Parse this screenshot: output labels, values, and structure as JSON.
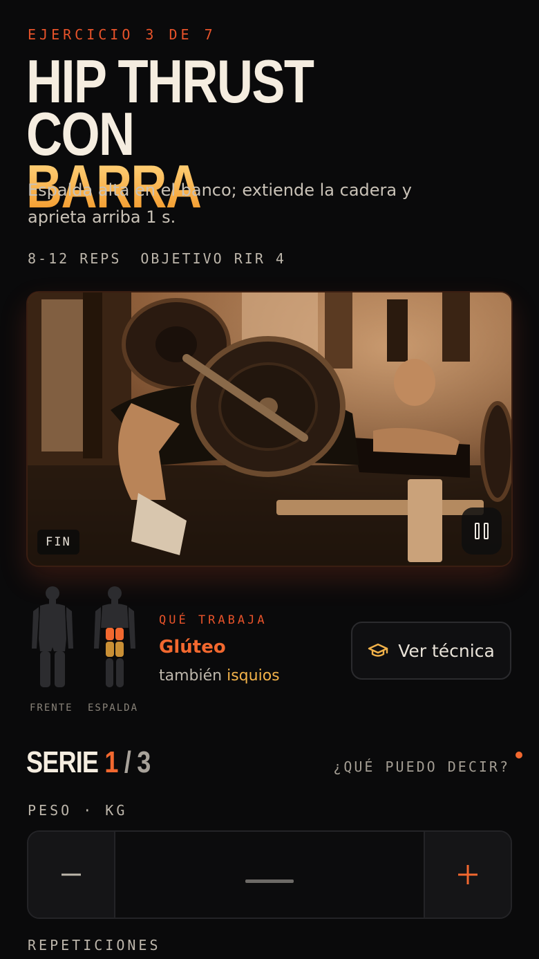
{
  "header": {
    "eyebrow": "EJERCICIO 3 DE 7",
    "title_line1": "HIP THRUST CON",
    "title_line2": "BARRA",
    "description": "Espalda alta en el banco; extiende la cadera y aprieta arriba 1 s.",
    "reps": "8-12 REPS",
    "target": "OBJETIVO RIR 4"
  },
  "video": {
    "badge": "FIN",
    "pause_icon": "pause-icon",
    "image_description": "sepia photo of a man performing a barbell hip thrust against a bench"
  },
  "muscles": {
    "front_label": "FRENTE",
    "back_label": "ESPALDA",
    "eyebrow": "QUÉ TRABAJA",
    "primary": "Glúteo",
    "also_prefix": "también",
    "secondary": "isquios",
    "technique_button": "Ver técnica",
    "technique_icon": "graduation-cap-icon"
  },
  "set": {
    "word": "SERIE",
    "current": "1",
    "separator": "/",
    "total": "3",
    "help": "¿QUÉ PUEDO DECIR?"
  },
  "weight": {
    "label": "PESO · KG",
    "value": "",
    "minus_icon": "minus-icon",
    "plus_icon": "plus-icon"
  },
  "reps_field": {
    "label": "REPETICIONES"
  },
  "colors": {
    "accent": "#e8532a",
    "accent_bright": "#f2682f",
    "gold": "#f7a83a",
    "background": "#0a0a0b"
  }
}
